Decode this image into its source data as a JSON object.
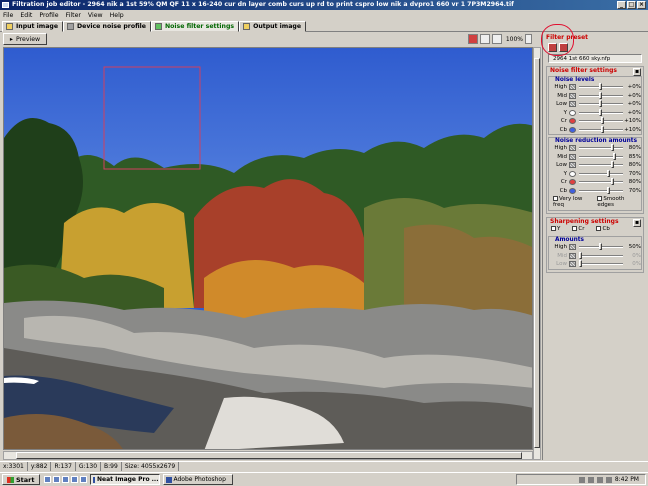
{
  "window": {
    "title": "Filtration job editor - 2964 nik a 1st 59% QM  QF 11 x 16-240 cur dn layer comb curs up rd to print cspro low nik a dvpro1 660 vr 1 7P3M2964.tif"
  },
  "menu": [
    "File",
    "Edit",
    "Profile",
    "Filter",
    "View",
    "Help"
  ],
  "tabs": [
    {
      "label": "Input image",
      "active": false
    },
    {
      "label": "Device noise profile",
      "active": false
    },
    {
      "label": "Noise filter settings",
      "active": true
    },
    {
      "label": "Output image",
      "active": false
    }
  ],
  "toolbar": {
    "preview_label": "Preview",
    "zoom": "100%"
  },
  "panel": {
    "filter_preset_title": "Filter preset",
    "preset_value": "2964 1st 660 sky.nfp",
    "noise_filter_settings_title": "Noise filter settings",
    "noise_levels_title": "Noise levels",
    "noise_levels": [
      {
        "label": "High",
        "value": "+0%",
        "pos": 0.5,
        "swatch": "pattern"
      },
      {
        "label": "Mid",
        "value": "+0%",
        "pos": 0.5,
        "swatch": "pattern"
      },
      {
        "label": "Low",
        "value": "+0%",
        "pos": 0.5,
        "swatch": "pattern"
      },
      {
        "label": "Y",
        "value": "+0%",
        "pos": 0.5,
        "swatch": "white"
      },
      {
        "label": "Cr",
        "value": "+10%",
        "pos": 0.55,
        "swatch": "red"
      },
      {
        "label": "Cb",
        "value": "+10%",
        "pos": 0.55,
        "swatch": "blue"
      }
    ],
    "noise_reduction_title": "Noise reduction amounts",
    "noise_reduction": [
      {
        "label": "High",
        "value": "80%",
        "pos": 0.8,
        "swatch": "pattern"
      },
      {
        "label": "Mid",
        "value": "85%",
        "pos": 0.85,
        "swatch": "pattern"
      },
      {
        "label": "Low",
        "value": "80%",
        "pos": 0.8,
        "swatch": "pattern"
      },
      {
        "label": "Y",
        "value": "70%",
        "pos": 0.7,
        "swatch": "white"
      },
      {
        "label": "Cr",
        "value": "80%",
        "pos": 0.8,
        "swatch": "red"
      },
      {
        "label": "Cb",
        "value": "70%",
        "pos": 0.7,
        "swatch": "blue"
      }
    ],
    "very_low_freq_label": "Very low freq",
    "smooth_edges_label": "Smooth edges",
    "sharpening_title": "Sharpening settings",
    "sharpen_channels": [
      "Y",
      "Cr",
      "Cb"
    ],
    "amounts_title": "Amounts",
    "amounts": [
      {
        "label": "High",
        "value": "50%",
        "pos": 0.5
      },
      {
        "label": "Mid",
        "value": "0%",
        "pos": 0.0
      },
      {
        "label": "Low",
        "value": "0%",
        "pos": 0.0
      }
    ]
  },
  "status": {
    "x": "x:3301",
    "y": "y:882",
    "r": "R:137",
    "g": "G:130",
    "b": "B:99",
    "size": "Size: 4055x2679"
  },
  "taskbar": {
    "start": "Start",
    "tasks": [
      {
        "label": "Neat Image Pro ...",
        "active": true
      },
      {
        "label": "Adobe Photoshop",
        "active": false
      }
    ],
    "clock": "8:42 PM"
  },
  "colors": {
    "accent_red": "#cc0000",
    "section_blue": "#000099",
    "active_tab_green": "#006600"
  }
}
